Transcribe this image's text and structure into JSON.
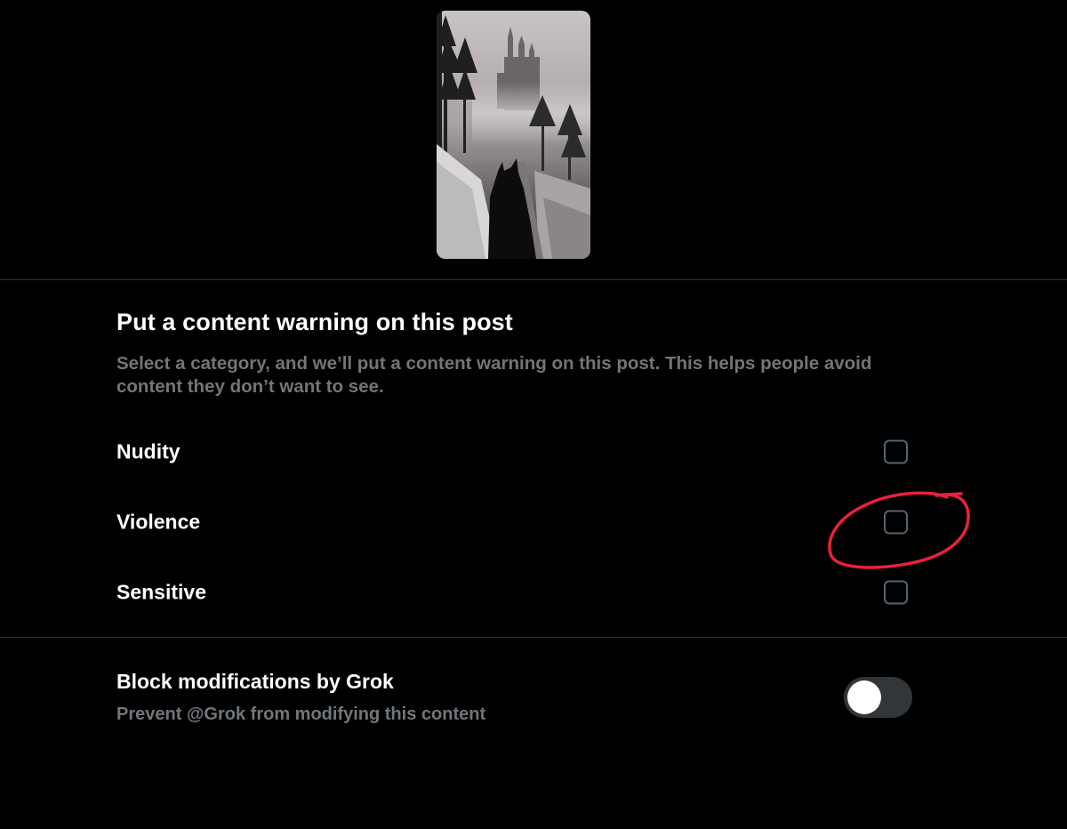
{
  "content_warning": {
    "title": "Put a content warning on this post",
    "description": "Select a category, and we’ll put a content warning on this post. This helps people avoid content they don’t want to see.",
    "options": [
      {
        "label": "Nudity",
        "checked": false
      },
      {
        "label": "Violence",
        "checked": false
      },
      {
        "label": "Sensitive",
        "checked": false
      }
    ]
  },
  "grok": {
    "title": "Block modifications by Grok",
    "subtitle": "Prevent @Grok from modifying this content",
    "toggle_on": false
  },
  "colors": {
    "background": "#000000",
    "text_primary": "#ffffff",
    "text_secondary": "#71767b",
    "divider": "#2f3336",
    "checkbox_border": "#536471",
    "toggle_track": "#333639",
    "annotation": "#e8213c"
  }
}
